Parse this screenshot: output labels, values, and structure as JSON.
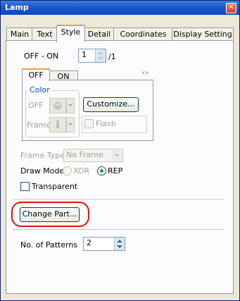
{
  "window": {
    "title": "Lamp",
    "close_glyph": "✕"
  },
  "tabs": [
    {
      "label": "Main"
    },
    {
      "label": "Text"
    },
    {
      "label": "Style"
    },
    {
      "label": "Detail"
    },
    {
      "label": "Coordinates"
    },
    {
      "label": "Display Setting"
    }
  ],
  "style": {
    "off_on_label": "OFF - ON",
    "off_on_value": "1",
    "off_on_total": "/1",
    "state_tabs": [
      {
        "label": "OFF"
      },
      {
        "label": "ON"
      }
    ],
    "tab_nav_glyph": "‹›",
    "color_group": {
      "title": "Color",
      "off_label": "OFF",
      "frame_label": "Frame",
      "customize_label": "Customize...",
      "flash_label": "Flash"
    },
    "frame_type_label": "Frame Type",
    "frame_type_value": "No Frame",
    "draw_mode_label": "Draw Mode",
    "xor_label": "XOR",
    "rep_label": "REP",
    "transparent_label": "Transparent",
    "change_part_label": "Change Part...",
    "patterns_label": "No. of Patterns",
    "patterns_value": "2"
  },
  "colors": {
    "highlight": "#e01010",
    "accent": "#f0a030",
    "title_bar": "#1955c8"
  }
}
